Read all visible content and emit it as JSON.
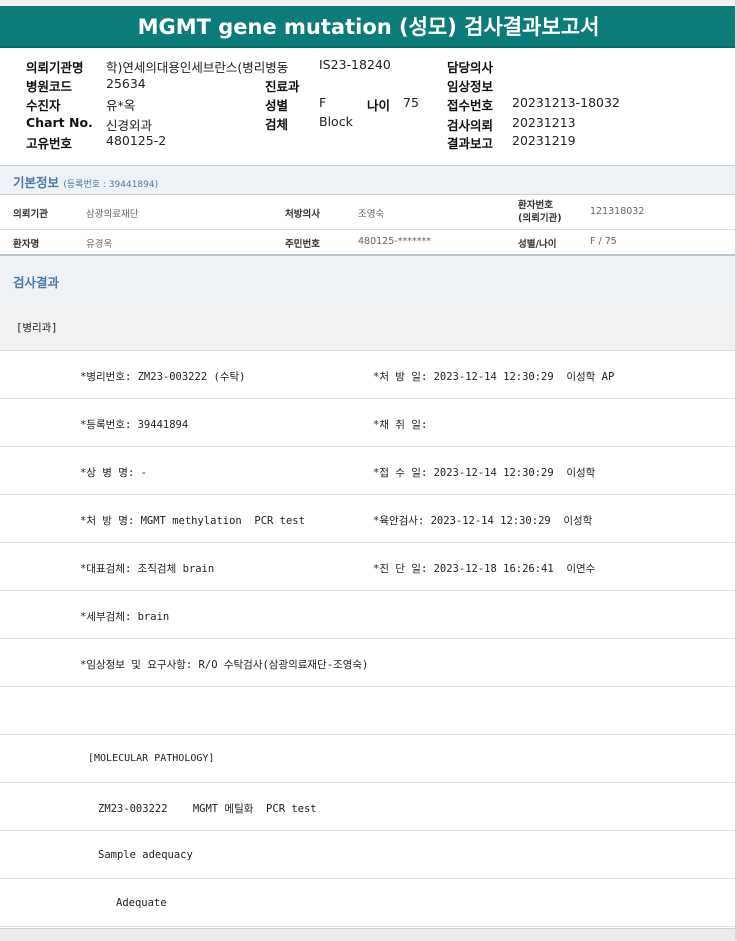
{
  "title": "MGMT gene mutation (성모) 검사결과보고서",
  "header": {
    "institution_label": "의뢰기관명",
    "institution_value": "학)연세의대용인세브란스(병리병동",
    "hospital_code_label": "병원코드",
    "hospital_code_value": "25634",
    "patient_label": "수진자",
    "patient_value": "유*옥",
    "chart_label": "Chart No.",
    "chart_value": "신경외과",
    "unique_label": "고유번호",
    "unique_value": "480125-2",
    "ward_value": "IS23-18240",
    "dept_label": "진료과",
    "sex_label": "성별",
    "sex_value": "F",
    "age_label": "나이",
    "age_value": "75",
    "specimen_label": "검체",
    "specimen_value": "Block",
    "doctor_label": "담당의사",
    "clinical_label": "임상정보",
    "receipt_label": "접수번호",
    "receipt_value": "20231213-18032",
    "request_label": "검사의뢰",
    "request_value": "20231213",
    "report_label": "결과보고",
    "report_value": "20231219"
  },
  "basic_info": {
    "title": "기본정보",
    "reg_no": "(등록번호 : 39441894)",
    "requester_label": "의뢰기관",
    "requester_value": "삼광의료재단",
    "prescriber_label": "처방의사",
    "prescriber_value": "조영숙",
    "patient_no_label": "환자번호",
    "patient_no_label2": "(의뢰기관)",
    "patient_no_value": "121318032",
    "name_label": "환자명",
    "name_value": "유경옥",
    "rrn_label": "주민번호",
    "rrn_value": "480125-*******",
    "sexage_label": "성별/나이",
    "sexage_value": "F / 75"
  },
  "results": {
    "title": "검사결과",
    "dept_tag": "[병리과]",
    "rows": [
      {
        "left": "*병리번호: ZM23-003222 (수탁)",
        "right": "*처 방 일: 2023-12-14 12:30:29  이성학 AP"
      },
      {
        "left": "*등록번호: 39441894",
        "right": "*채 취 일:"
      },
      {
        "left": "*상 병 명: -",
        "right": "*접 수 일: 2023-12-14 12:30:29  이성학"
      },
      {
        "left": "*처 방 명: MGMT methylation  PCR test",
        "right": "*육안검사: 2023-12-14 12:30:29  이성학"
      },
      {
        "left": "*대표검체: 조직검체 brain",
        "right": "*진 단 일: 2023-12-18 16:26:41  이연수"
      },
      {
        "left": "*세부검체: brain",
        "right": ""
      },
      {
        "left": "*임상정보 및 요구사항: R/O 수탁검사(삼광의료재단-조영숙)",
        "right": ""
      }
    ],
    "molecular_tag": "[MOLECULAR PATHOLOGY]",
    "molecular_test": "ZM23-003222    MGMT 메틸화  PCR test",
    "sample_label": "Sample adequacy",
    "sample_value": "Adequate"
  }
}
